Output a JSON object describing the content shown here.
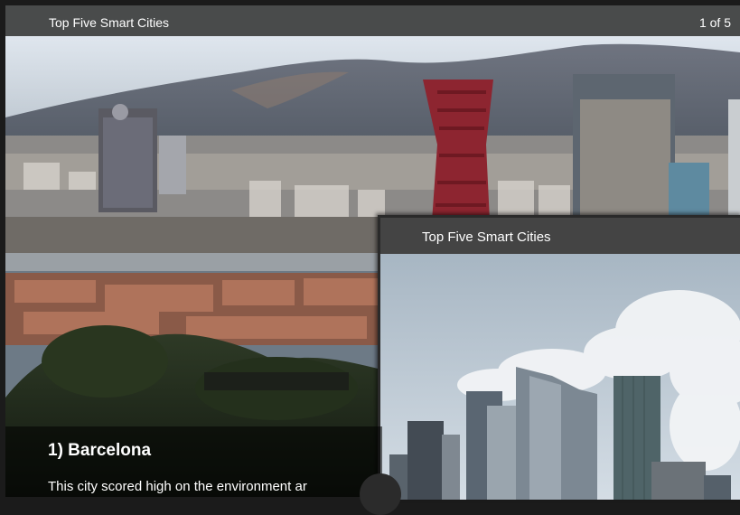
{
  "slideshow": {
    "title": "Top Five Smart Cities",
    "counter": "1 of 5",
    "slide": {
      "heading": "1) Barcelona",
      "text": "This city scored high on the environment ar"
    }
  },
  "mini_player": {
    "title": "Top Five Smart Cities"
  }
}
